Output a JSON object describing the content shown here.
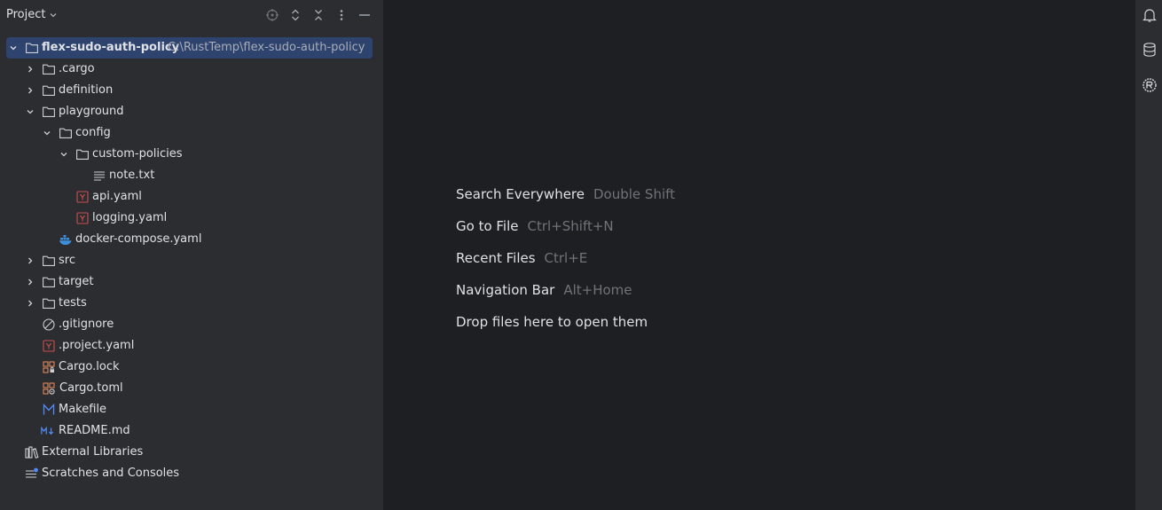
{
  "project_panel": {
    "title": "Project",
    "header_icons": [
      "locate-icon",
      "expand-all-icon",
      "collapse-all-icon",
      "more-options-icon",
      "minimize-icon"
    ]
  },
  "tree": {
    "root": {
      "label": "flex-sudo-auth-policy",
      "path": "C:\\RustTemp\\flex-sudo-auth-policy"
    },
    "items": [
      {
        "label": ".cargo"
      },
      {
        "label": "definition"
      },
      {
        "label": "playground"
      },
      {
        "label": "config"
      },
      {
        "label": "custom-policies"
      },
      {
        "label": "note.txt"
      },
      {
        "label": "api.yaml"
      },
      {
        "label": "logging.yaml"
      },
      {
        "label": "docker-compose.yaml"
      },
      {
        "label": "src"
      },
      {
        "label": "target"
      },
      {
        "label": "tests"
      },
      {
        "label": ".gitignore"
      },
      {
        "label": ".project.yaml"
      },
      {
        "label": "Cargo.lock"
      },
      {
        "label": "Cargo.toml"
      },
      {
        "label": "Makefile"
      },
      {
        "label": "README.md"
      },
      {
        "label": "External Libraries"
      },
      {
        "label": "Scratches and Consoles"
      }
    ]
  },
  "editor_hints": [
    {
      "action": "Search Everywhere",
      "shortcut": "Double Shift"
    },
    {
      "action": "Go to File",
      "shortcut": "Ctrl+Shift+N"
    },
    {
      "action": "Recent Files",
      "shortcut": "Ctrl+E"
    },
    {
      "action": "Navigation Bar",
      "shortcut": "Alt+Home"
    },
    {
      "action": "Drop files here to open them",
      "shortcut": ""
    }
  ],
  "right_strip": [
    "notifications-icon",
    "database-icon",
    "rust-icon"
  ],
  "colors": {
    "panel_bg": "#2b2d30",
    "editor_bg": "#1e1f22",
    "selection": "#2e436e",
    "text": "#dfe1e5",
    "muted": "#6f737a",
    "yaml_red": "#c94f4f",
    "docker_blue": "#3d8fdb"
  }
}
